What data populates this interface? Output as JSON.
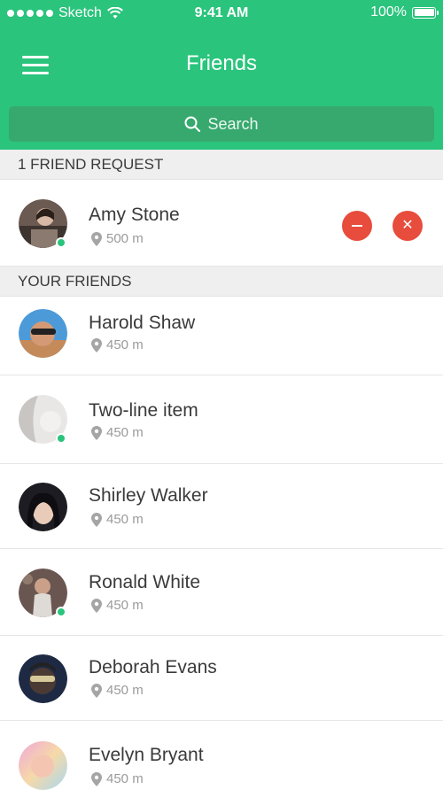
{
  "status_bar": {
    "carrier": "Sketch",
    "time": "9:41 AM",
    "battery": "100%"
  },
  "nav": {
    "title": "Friends",
    "menu_icon": "hamburger-menu-icon"
  },
  "search": {
    "placeholder": "Search",
    "icon": "search-icon"
  },
  "colors": {
    "accent": "#2ac47c",
    "search_bg": "#37a96e",
    "danger": "#e74c3c",
    "online": "#2ac47c"
  },
  "friend_requests": {
    "header": "1 FRIEND REQUEST",
    "items": [
      {
        "name": "Amy Stone",
        "distance": "500 m",
        "online": true
      }
    ]
  },
  "friends": {
    "header": "YOUR FRIENDS",
    "items": [
      {
        "name": "Harold Shaw",
        "distance": "450 m",
        "online": false
      },
      {
        "name": "Two-line item",
        "distance": "450 m",
        "online": true
      },
      {
        "name": "Shirley Walker",
        "distance": "450 m",
        "online": false
      },
      {
        "name": "Ronald White",
        "distance": "450 m",
        "online": true
      },
      {
        "name": "Deborah Evans",
        "distance": "450 m",
        "online": false
      },
      {
        "name": "Evelyn Bryant",
        "distance": "450 m",
        "online": false
      }
    ]
  }
}
